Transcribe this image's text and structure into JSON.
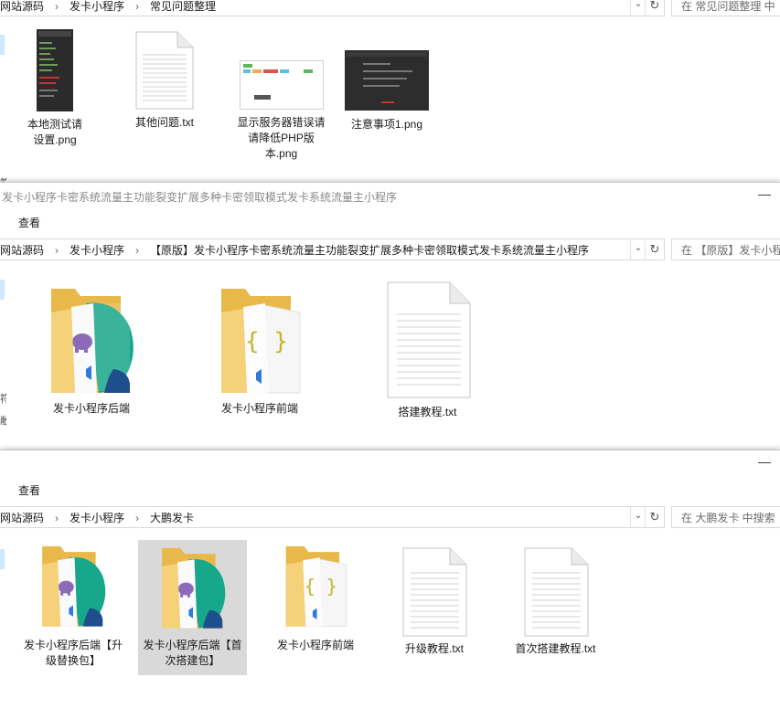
{
  "window_top": {
    "address": {
      "crumbs": [
        "网站源码",
        "发卡小程序",
        "常见问题整理"
      ]
    },
    "search_placeholder": "在 常见问题整理 中",
    "items": [
      {
        "label": "本地测试请设置.png"
      },
      {
        "label": "其他问题.txt"
      },
      {
        "label": "显示服务器错误请请降低PHP版本.png"
      },
      {
        "label": "注意事项1.png"
      }
    ],
    "nav_glyphs": [
      "符",
      "敝"
    ]
  },
  "window_mid": {
    "title": "发卡小程序卡密系统流量主功能裂变扩展多种卡密领取模式发卡系统流量主小程序",
    "ribbon_tab": "查看",
    "address": {
      "crumbs": [
        "网站源码",
        "发卡小程序",
        "【原版】发卡小程序卡密系统流量主功能裂变扩展多种卡密领取模式发卡系统流量主小程序"
      ]
    },
    "search_placeholder": "在 【原版】发卡小程",
    "items": [
      {
        "label": "发卡小程序后端"
      },
      {
        "label": "发卡小程序前端"
      },
      {
        "label": "搭建教程.txt"
      }
    ],
    "nav_glyphs": [
      "符",
      "敝"
    ]
  },
  "window_bot": {
    "ribbon_tab": "查看",
    "address": {
      "crumbs": [
        "网站源码",
        "发卡小程序",
        "大鹏发卡"
      ]
    },
    "search_placeholder": "在 大鹏发卡 中搜索",
    "items": [
      {
        "label": "发卡小程序后端【升级替换包】"
      },
      {
        "label": "发卡小程序后端【首次搭建包】"
      },
      {
        "label": "发卡小程序前端"
      },
      {
        "label": "升级教程.txt"
      },
      {
        "label": "首次搭建教程.txt"
      }
    ]
  },
  "colors": {
    "folder": "#f5d27a",
    "folder_dark": "#e8b94a",
    "selection": "#d9d9d9",
    "nav_selected": "#cde8ff",
    "title_text": "#8a8a8a"
  },
  "icons": {
    "close": "×",
    "minimize": "—",
    "dropdown": "⌄",
    "refresh": "↻",
    "breadcrumb_separator": "›"
  }
}
